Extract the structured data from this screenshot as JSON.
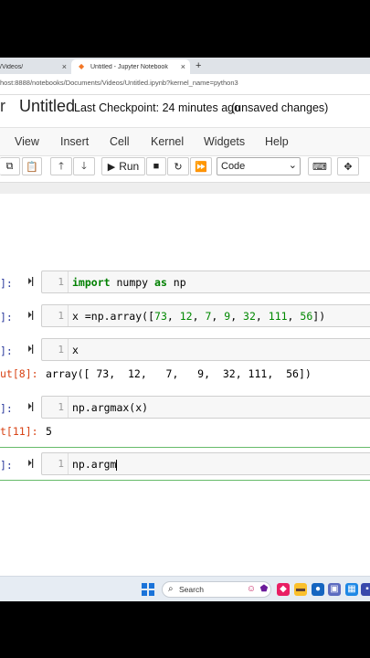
{
  "browser": {
    "tab1_title": "/Videos/",
    "tab2_title": "Untitled - Jupyter Notebook",
    "address": "host:8888/notebooks/Documents/Videos/Untitled.ipynb?kernel_name=python3"
  },
  "header": {
    "logo_fragment": "r",
    "notebook_title": "Untitled",
    "checkpoint": "Last Checkpoint: 24 minutes ago",
    "unsaved": "(unsaved changes)"
  },
  "menu": [
    "View",
    "Insert",
    "Cell",
    "Kernel",
    "Widgets",
    "Help"
  ],
  "toolbar": {
    "run_label": "Run",
    "cell_type": "Code"
  },
  "cells": [
    {
      "prompt": "]:",
      "line": "1",
      "code": "import numpy as np"
    },
    {
      "prompt": "]:",
      "line": "1",
      "code": "x =np.array([73, 12, 7, 9, 32, 111, 56])"
    },
    {
      "prompt": "]:",
      "line": "1",
      "code": "x",
      "out_prompt": "ut[8]:",
      "output": "array([ 73,  12,   7,   9,  32, 111,  56])"
    },
    {
      "prompt": "]:",
      "line": "1",
      "code": "np.argmax(x)",
      "out_prompt": "t[11]:",
      "output": "5"
    },
    {
      "prompt": "]:",
      "line": "1",
      "code": "np.argm"
    }
  ],
  "taskbar": {
    "search_placeholder": "Search"
  },
  "colors": {
    "prompt_in": "#303f9f",
    "prompt_out": "#d84315",
    "selected_border": "#66bb6a",
    "keyword": "#008000"
  }
}
